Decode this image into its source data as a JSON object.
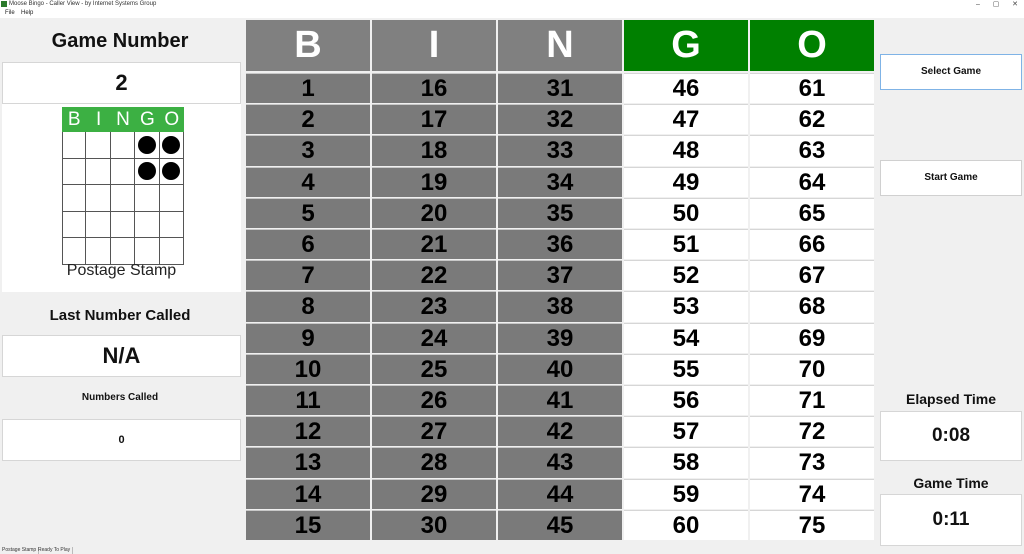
{
  "window": {
    "title": "Moose Bingo - Caller View - by Internet Systems Group",
    "controls": [
      "–",
      "▢",
      "✕"
    ]
  },
  "menu": {
    "items": [
      "File",
      "Help"
    ]
  },
  "left_panel": {
    "game_number_label": "Game Number",
    "game_number_value": "2",
    "pattern": {
      "header": [
        "B",
        "I",
        "N",
        "G",
        "O"
      ],
      "marked": [
        [
          false,
          false,
          false,
          true,
          true
        ],
        [
          false,
          false,
          false,
          true,
          true
        ],
        [
          false,
          false,
          false,
          false,
          false
        ],
        [
          false,
          false,
          false,
          false,
          false
        ],
        [
          false,
          false,
          false,
          false,
          false
        ]
      ],
      "name": "Postage Stamp"
    },
    "last_number_label": "Last Number Called",
    "last_number_value": "N/A",
    "numbers_called_label": "Numbers Called",
    "numbers_called_value": "0"
  },
  "board": {
    "columns": [
      {
        "letter": "B",
        "header_color": "#808080",
        "numbers": [
          "1",
          "2",
          "3",
          "4",
          "5",
          "6",
          "7",
          "8",
          "9",
          "10",
          "11",
          "12",
          "13",
          "14",
          "15"
        ],
        "called": false
      },
      {
        "letter": "I",
        "header_color": "#808080",
        "numbers": [
          "16",
          "17",
          "18",
          "19",
          "20",
          "21",
          "22",
          "23",
          "24",
          "25",
          "26",
          "27",
          "28",
          "29",
          "30"
        ],
        "called": false
      },
      {
        "letter": "N",
        "header_color": "#808080",
        "numbers": [
          "31",
          "32",
          "33",
          "34",
          "35",
          "36",
          "37",
          "38",
          "39",
          "40",
          "41",
          "42",
          "43",
          "44",
          "45"
        ],
        "called": false
      },
      {
        "letter": "G",
        "header_color": "#008000",
        "numbers": [
          "46",
          "47",
          "48",
          "49",
          "50",
          "51",
          "52",
          "53",
          "54",
          "55",
          "56",
          "57",
          "58",
          "59",
          "60"
        ],
        "called": true
      },
      {
        "letter": "O",
        "header_color": "#008000",
        "numbers": [
          "61",
          "62",
          "63",
          "64",
          "65",
          "66",
          "67",
          "68",
          "69",
          "70",
          "71",
          "72",
          "73",
          "74",
          "75"
        ],
        "called": true
      }
    ]
  },
  "right_panel": {
    "select_game_label": "Select Game",
    "start_game_label": "Start Game",
    "elapsed_time_label": "Elapsed Time",
    "elapsed_time_value": "0:08",
    "game_time_label": "Game Time",
    "game_time_value": "0:11"
  },
  "status_bar": {
    "segments": [
      "Postage Stamp",
      "Ready To Play"
    ]
  },
  "colors": {
    "uncalled_cell": "#7a7a7a",
    "called_cell": "#ffffff",
    "pattern_header": "#3cb043"
  }
}
